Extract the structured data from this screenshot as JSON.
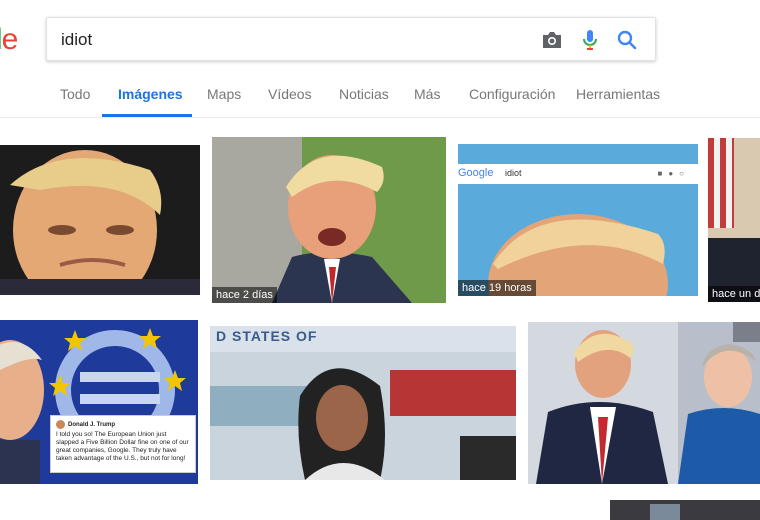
{
  "logo": {
    "partial": "le",
    "l_color": "#34a853",
    "e_color": "#ea4335"
  },
  "search": {
    "query": "idiot",
    "icons": [
      "camera-icon",
      "microphone-icon",
      "search-icon"
    ]
  },
  "tabs": {
    "items": [
      "Todo",
      "Imágenes",
      "Maps",
      "Vídeos",
      "Noticias",
      "Más",
      "Configuración",
      "Herramientas"
    ],
    "active": "Imágenes",
    "accent": "#1a73e8"
  },
  "results": {
    "captions": [
      "hace 2 días",
      "hace 19 horas",
      "hace un d"
    ],
    "mini_search": {
      "logo": "Google",
      "query": "idiot"
    },
    "tweet": {
      "author": "Donald J. Trump",
      "text": "I told you so! The European Union just slapped a Five Billion Dollar fine on one of our great companies, Google. They truly have taken advantage of the U.S., but not for long!"
    },
    "banner_text": "D STATES OF"
  }
}
